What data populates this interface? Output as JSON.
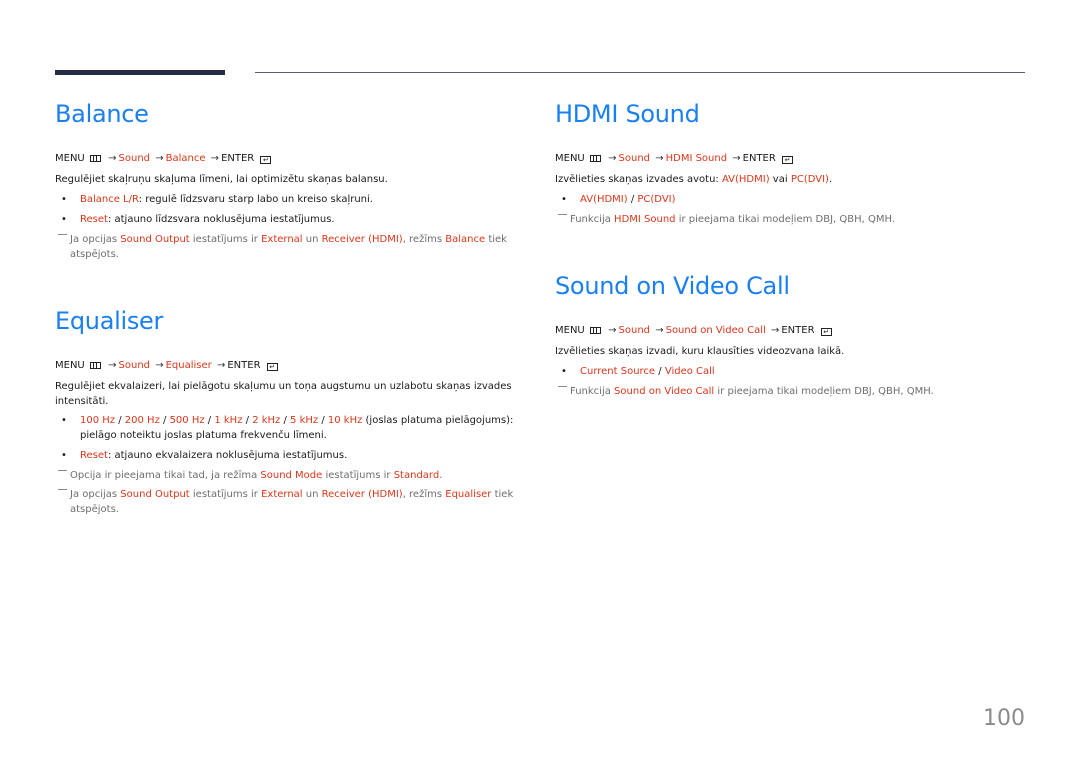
{
  "page_number": "100",
  "menu_common": {
    "menu": "MENU",
    "enter": "ENTER",
    "arrow": "→",
    "sound": "Sound"
  },
  "balance": {
    "title": "Balance",
    "menu_item": "Balance",
    "description": "Regulējiet skaļruņu skaļuma līmeni, lai optimizētu skaņas balansu.",
    "bullets": [
      {
        "term": "Balance L/R",
        "text": ": regulē līdzsvaru starp labo un kreiso skaļruni."
      },
      {
        "term": "Reset",
        "text": ": atjauno līdzsvara noklusējuma iestatījumus."
      }
    ],
    "note": {
      "p1": "Ja opcijas ",
      "h1": "Sound Output",
      "p2": " iestatījums ir ",
      "h2": "External",
      "p3": " un ",
      "h3": "Receiver (HDMI)",
      "p4": ", režīms ",
      "h4": "Balance",
      "p5": " tiek atspējots."
    }
  },
  "equaliser": {
    "title": "Equaliser",
    "menu_item": "Equaliser",
    "description": "Regulējiet ekvalaizeri, lai pielāgotu skaļumu un toņa augstumu un uzlabotu skaņas izvades intensitāti.",
    "bands": [
      "100 Hz",
      "200 Hz",
      "500 Hz",
      "1 kHz",
      "2 kHz",
      "5 kHz",
      "10 kHz"
    ],
    "band_separator": " / ",
    "bands_text": " (joslas platuma pielāgojums): pielāgo noteiktu joslas platuma frekvenču līmeni.",
    "reset": {
      "term": "Reset",
      "text": ": atjauno ekvalaizera noklusējuma iestatījumus."
    },
    "note1": {
      "p1": "Opcija ir pieejama tikai tad, ja režīma ",
      "h1": "Sound Mode",
      "p2": " iestatījums ir ",
      "h2": "Standard",
      "p3": "."
    },
    "note2": {
      "p1": "Ja opcijas ",
      "h1": "Sound Output",
      "p2": " iestatījums ir ",
      "h2": "External",
      "p3": " un ",
      "h3": "Receiver (HDMI)",
      "p4": ", režīms ",
      "h4": "Equaliser",
      "p5": " tiek atspējots."
    }
  },
  "hdmi_sound": {
    "title": "HDMI Sound",
    "menu_item": "HDMI Sound",
    "description": {
      "p1": "Izvēlieties skaņas izvades avotu: ",
      "h1": "AV(HDMI)",
      "p2": " vai ",
      "h2": "PC(DVI)",
      "p3": "."
    },
    "options": [
      "AV(HDMI)",
      "PC(DVI)"
    ],
    "option_separator": " / ",
    "note": {
      "p1": "Funkcija ",
      "h1": "HDMI Sound",
      "p2": " ir pieejama tikai modeļiem DBJ, QBH, QMH."
    }
  },
  "sound_on_video_call": {
    "title": "Sound on Video Call",
    "menu_item": "Sound on Video Call",
    "description": "Izvēlieties skaņas izvadi, kuru klausīties videozvana laikā.",
    "options": [
      "Current Source",
      "Video Call"
    ],
    "option_separator": " / ",
    "note": {
      "p1": "Funkcija ",
      "h1": "Sound on Video Call",
      "p2": " ir pieejama tikai modeļiem DBJ, QBH, QMH."
    }
  }
}
